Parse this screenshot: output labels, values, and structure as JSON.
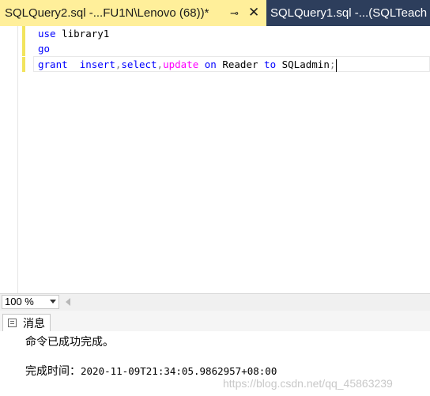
{
  "tabs": {
    "active": {
      "title": "SQLQuery2.sql -...FU1N\\Lenovo (68))*",
      "pin_icon": "pin-icon",
      "pin_glyph": "⊸",
      "close_glyph": "✕"
    },
    "other": {
      "title": "SQLQuery1.sql -...(SQLTeach"
    }
  },
  "editor": {
    "lines": [
      {
        "tokens": [
          {
            "text": "use",
            "cls": "kw"
          },
          {
            "text": " library1",
            "cls": ""
          }
        ]
      },
      {
        "tokens": [
          {
            "text": "go",
            "cls": "kw"
          }
        ]
      },
      {
        "tokens": [
          {
            "text": "grant",
            "cls": "kw"
          },
          {
            "text": "  ",
            "cls": ""
          },
          {
            "text": "insert",
            "cls": "kw"
          },
          {
            "text": ",",
            "cls": "gray"
          },
          {
            "text": "select",
            "cls": "kw"
          },
          {
            "text": ",",
            "cls": "gray"
          },
          {
            "text": "update",
            "cls": "fn"
          },
          {
            "text": " ",
            "cls": ""
          },
          {
            "text": "on",
            "cls": "kw"
          },
          {
            "text": " Reader ",
            "cls": ""
          },
          {
            "text": "to",
            "cls": "kw"
          },
          {
            "text": " SQLadmin",
            "cls": ""
          },
          {
            "text": ";",
            "cls": "gray"
          }
        ]
      }
    ]
  },
  "zoom": {
    "value": "100 %"
  },
  "results": {
    "tab_label": "消息",
    "message": "命令已成功完成。",
    "completion_label": "完成时间：",
    "completion_value": "2020-11-09T21:34:05.9862957+08:00"
  },
  "watermark": "https://blog.csdn.net/qq_45863239",
  "colors": {
    "tab_strip": "#2d3e5c",
    "active_tab": "#ffef9a",
    "keyword": "#0000ff",
    "function": "#ff00ff",
    "change_bar": "#f2e45d"
  }
}
